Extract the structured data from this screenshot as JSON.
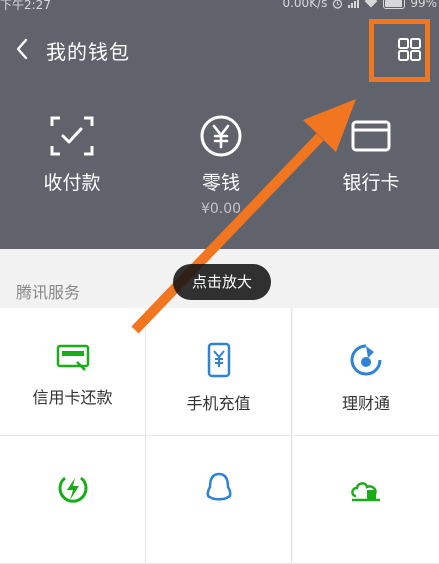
{
  "status_bar": {
    "time": "下午2:27",
    "network_speed": "0.00K/s",
    "battery": "99%"
  },
  "nav": {
    "title": "我的钱包"
  },
  "quick_actions": [
    {
      "label": "收付款",
      "icon": "scan-icon"
    },
    {
      "label": "零钱",
      "sublabel": "¥0.00",
      "icon": "yuan-coin-icon"
    },
    {
      "label": "银行卡",
      "icon": "bank-card-icon"
    }
  ],
  "tencent_services": {
    "title": "腾讯服务",
    "items": [
      {
        "label": "信用卡还款",
        "icon": "credit-card-icon"
      },
      {
        "label": "手机充值",
        "icon": "phone-yuan-icon"
      },
      {
        "label": "理财通",
        "icon": "wealth-icon"
      },
      {
        "label": "",
        "icon": "lightning-icon"
      },
      {
        "label": "",
        "icon": "qq-icon"
      },
      {
        "label": "",
        "icon": "cloud-building-icon"
      }
    ]
  },
  "overlay": {
    "tooltip": "点击放大"
  },
  "colors": {
    "header_bg": "#60636c",
    "accent_green": "#1aad19",
    "accent_blue": "#2f83d6",
    "annotation_orange": "#f2761f"
  }
}
